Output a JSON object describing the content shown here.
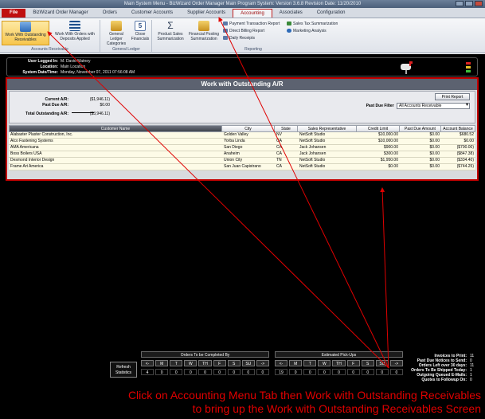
{
  "window": {
    "title": "Main System Menu - BizWizard Order Manager Main Program System: Version 3.6.8  Revision Date: 11/20/2010"
  },
  "tabs": [
    {
      "label": "File"
    },
    {
      "label": "BizWizard Order Manager"
    },
    {
      "label": "Orders"
    },
    {
      "label": "Customer Accounts"
    },
    {
      "label": "Supplier Accounts"
    },
    {
      "label": "Accounting"
    },
    {
      "label": "Associates"
    },
    {
      "label": "Configuration"
    }
  ],
  "ribbon": {
    "groups": [
      {
        "label": "Accounts Receivable"
      },
      {
        "label": "General Ledger"
      },
      {
        "label": "Reporting"
      }
    ],
    "buttons": {
      "work_outstanding": "Work With Outstanding Receivables",
      "work_deposits": "Work With Orders with Deposits Applied",
      "gl_categories": "General Ledger Categories",
      "close_financials": "Close Financials",
      "product_sales": "Product Sales Summarization",
      "financial_posting": "Financial Posting Summarization",
      "payment_report": "Payment Transaction Report",
      "direct_billing": "Direct Billing Report",
      "daily_receipts": "Daily Receipts",
      "sales_tax": "Sales Tax Summarization",
      "marketing": "Marketing Analysis"
    }
  },
  "userinfo": {
    "user_label": "User Logged In:",
    "user_value": "M. David Matney",
    "location_label": "Location:",
    "location_value": "Main Location",
    "datetime_label": "System Date/Time:",
    "datetime_value": "Monday, November 07, 2011  07:56:08 AM"
  },
  "panel": {
    "title": "Work with Outstanding A/R",
    "current_label": "Current A/R:",
    "current_value": "($1,946.11)",
    "pastdue_label": "Past Due A/R:",
    "pastdue_value": "$0.00",
    "total_label": "Total Outstanding A/R:",
    "total_value": "($3,946.11)",
    "print_button": "Print Report",
    "filter_label": "Past Due Filter",
    "filter_value": "All Accounts Receivable"
  },
  "table": {
    "columns": [
      "Customer Name",
      "City",
      "State",
      "Sales Representative",
      "Credit Limit",
      "Past Due Amount",
      "Account Balance"
    ],
    "rows": [
      [
        "Alabaster Plaster Construction, Inc.",
        "Golden Valley",
        "NV",
        "NetSoft Studio",
        "$10,000.00",
        "$0.00",
        "$680.52"
      ],
      [
        "Alco Fastening Systems",
        "Yorba Linda",
        "CA",
        "NetSoft Studio",
        "$10,000.00",
        "$0.00",
        "$0.00"
      ],
      [
        "AMA Americana",
        "San Diego",
        "CA",
        "Jack Johansen",
        "$900.00",
        "$0.00",
        "($790.00)"
      ],
      [
        "Boss Boilers USA",
        "Anaheim",
        "CA",
        "Jack Johansen",
        "$300.00",
        "$0.00",
        "($847.38)"
      ],
      [
        "Desmond Interior Design",
        "Union City",
        "TN",
        "NetSoft Studio",
        "$1,950.00",
        "$0.00",
        "($334.40)"
      ],
      [
        "Frame Art America",
        "San Juan Capistrano",
        "CA",
        "NetSoft Studio",
        "$0.00",
        "$0.00",
        "($744.25)"
      ]
    ]
  },
  "footer": {
    "refresh_label": "Refresh Statistics",
    "orders_title": "Orders To be Completed By",
    "orders_days": [
      "<-",
      "M",
      "T",
      "W",
      "TH",
      "F",
      "S",
      "SU",
      "->"
    ],
    "orders_counts": [
      "4",
      "0",
      "0",
      "0",
      "0",
      "0",
      "0",
      "0",
      "0"
    ],
    "pickups_title": "Estimated Pick-Ups",
    "pickups_days": [
      "<-",
      "M",
      "T",
      "W",
      "TH",
      "F",
      "S",
      "SU",
      "->"
    ],
    "pickups_counts": [
      "19",
      "0",
      "0",
      "0",
      "0",
      "0",
      "0",
      "0",
      "0"
    ],
    "stats": [
      {
        "label": "Invoices to Print:",
        "value": "11"
      },
      {
        "label": "Past Due Notices to Send:",
        "value": "0"
      },
      {
        "label": "Orders Left over 30 days:",
        "value": "11"
      },
      {
        "label": "Orders To Be Shipped Today:",
        "value": "1"
      },
      {
        "label": "Outgoing Queued E-Mails:",
        "value": "1"
      },
      {
        "label": "Quotes to Followup On:",
        "value": "0"
      }
    ]
  },
  "annotation": {
    "line1": "Click on Accounting Menu Tab then Work with Outstanding Receivables",
    "line2": "to bring up the Work with Outstanding Receivables Screen",
    "color": "#e00000"
  },
  "colors": {
    "accent_red": "#c40000",
    "file_tab": "#c01010",
    "row_bg": "#fdfbe7"
  }
}
